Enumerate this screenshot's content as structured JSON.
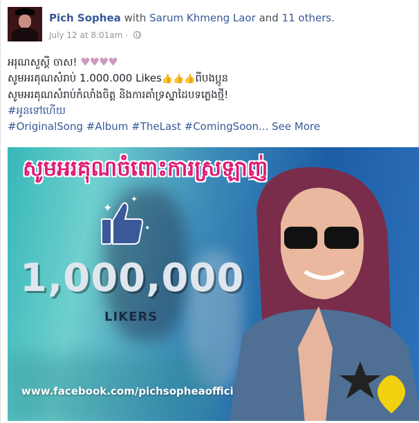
{
  "post": {
    "author": "Pich Sophea",
    "with_word": "with",
    "tagged": "Sarum Khmeng Laor",
    "and_word": "and",
    "others": "11 others",
    "period": ".",
    "timestamp": "July 12 at 8:01am",
    "dot": "·",
    "privacy_icon": "globe-icon"
  },
  "text": {
    "line1": "អរុណសួស្តី ចាស!",
    "hearts": "♥♥♥♥",
    "line2_a": "សូមអរគុណសំរាប់ 1.000.000 Likes",
    "thumbs": "👍👍👍",
    "line2_b": "ពីបងប្អូន",
    "line3": "សូមអរគុណសំរាប់កំលាំងចិត្ត និងការគាំទ្រស្នាដៃបទភ្លេងថ្មី!",
    "hashtag_khmer": "#អូនទៅហើយ",
    "hashtags": "#OriginalSong #Album #TheLast #ComingSoon...",
    "see_more": "See More"
  },
  "photo": {
    "banner": "សូមអរគុណចំពោះការស្រឡាញ់",
    "count": "1,000,000",
    "likers": "LIKERS",
    "url": "www.facebook.com/pichsopheaofficial"
  },
  "colors": {
    "link": "#365899",
    "banner": "#e11b74",
    "heart": "#cc9bc2"
  }
}
